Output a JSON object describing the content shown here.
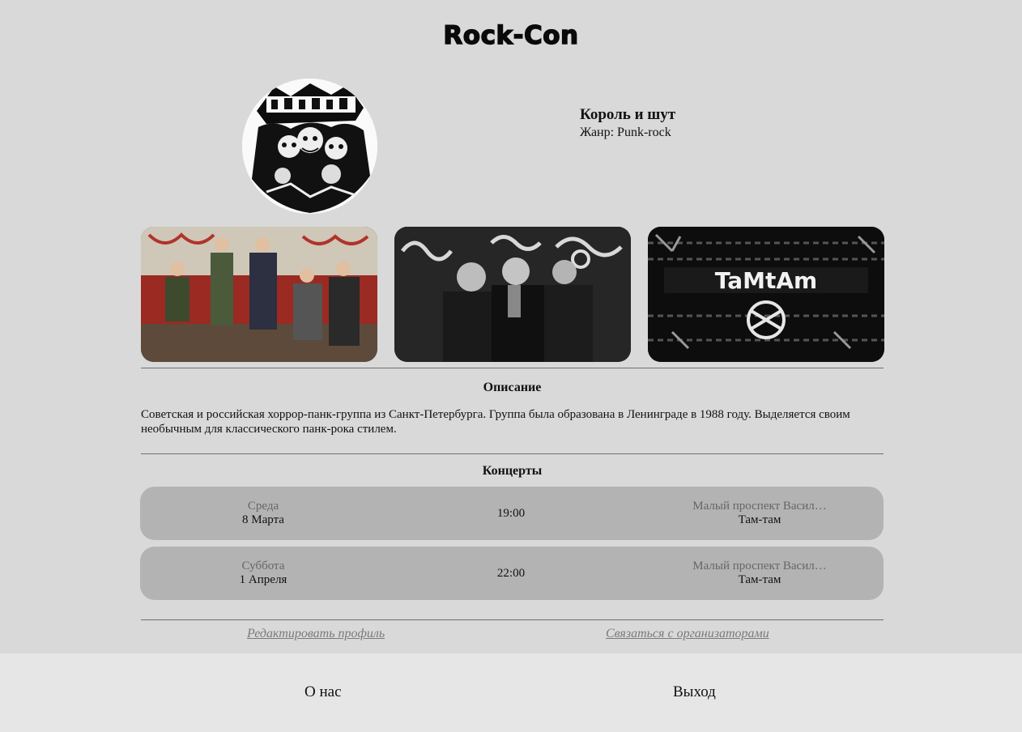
{
  "header": {
    "logo": "Rock-Con"
  },
  "band": {
    "name": "Король и шут",
    "genre_label": "Жанр:",
    "genre": "Punk-rock",
    "avatar_icon": "band-logo-image"
  },
  "photos": [
    {
      "icon": "band-photo-image"
    },
    {
      "icon": "band-photo-image"
    },
    {
      "icon": "band-photo-image"
    }
  ],
  "description": {
    "title": "Описание",
    "text": "Советская и российская хоррор-панк-группа из Санкт-Петербурга. Группа была образована в Ленинграде в 1988 году. Выделяется своим необычным для классического панк-рока стилем."
  },
  "concerts": {
    "title": "Концерты",
    "items": [
      {
        "day": "Среда",
        "date": "8 Марта",
        "time": "19:00",
        "address": "Малый проспект Васил…",
        "venue": "Там-там"
      },
      {
        "day": "Суббота",
        "date": "1 Апреля",
        "time": "22:00",
        "address": "Малый проспект Васил…",
        "venue": "Там-там"
      }
    ]
  },
  "links": {
    "edit_profile": "Редактировать профиль",
    "contact": "Связаться с организаторами"
  },
  "footer": {
    "about": "О нас",
    "logout": "Выход"
  },
  "colors": {
    "background": "#d9d9d9",
    "card": "#b3b3b3",
    "footer": "#e6e6e6",
    "muted_text": "#666666"
  }
}
